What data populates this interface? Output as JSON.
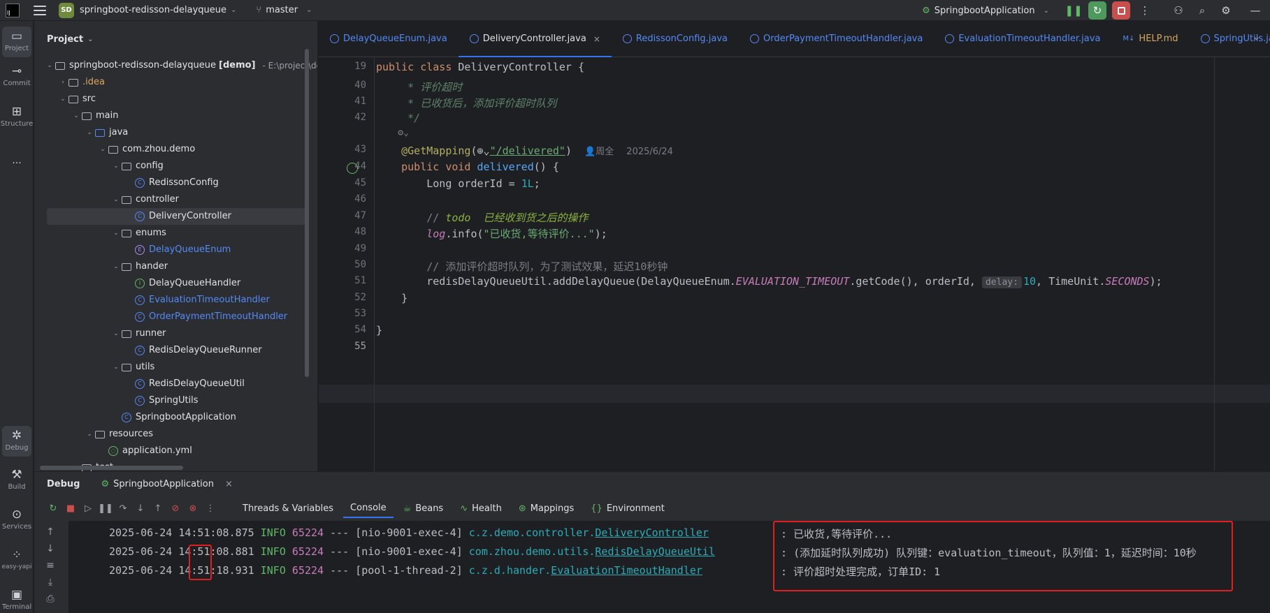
{
  "topbar": {
    "project_badge": "SD",
    "project_name": "springboot-redisson-delayqueue",
    "branch": "master",
    "run_config": "SpringbootApplication"
  },
  "toolstrip": {
    "project": "Project",
    "commit": "Commit",
    "structure": "Structure",
    "more": "···",
    "debug": "Debug",
    "build": "Build",
    "services": "Services",
    "easy_yapi": "easy-yapi",
    "terminal": "Terminal"
  },
  "project_panel": {
    "title": "Project",
    "tree": [
      {
        "label": "springboot-redisson-delayqueue",
        "bold_suffix": "[demo]",
        "path": "- E:\\project\\dela",
        "indent": 0,
        "arrow": "v",
        "icon": "folder"
      },
      {
        "label": ".idea",
        "indent": 1,
        "arrow": ">",
        "icon": "folder",
        "color": "orange"
      },
      {
        "label": "src",
        "indent": 1,
        "arrow": "v",
        "icon": "folder"
      },
      {
        "label": "main",
        "indent": 2,
        "arrow": "v",
        "icon": "folder"
      },
      {
        "label": "java",
        "indent": 3,
        "arrow": "v",
        "icon": "folder-blue"
      },
      {
        "label": "com.zhou.demo",
        "indent": 4,
        "arrow": "v",
        "icon": "folder"
      },
      {
        "label": "config",
        "indent": 5,
        "arrow": "v",
        "icon": "folder"
      },
      {
        "label": "RedissonConfig",
        "indent": 6,
        "arrow": "",
        "icon": "class"
      },
      {
        "label": "controller",
        "indent": 5,
        "arrow": "v",
        "icon": "folder"
      },
      {
        "label": "DeliveryController",
        "indent": 6,
        "arrow": "",
        "icon": "class",
        "selected": true
      },
      {
        "label": "enums",
        "indent": 5,
        "arrow": "v",
        "icon": "folder"
      },
      {
        "label": "DelayQueueEnum",
        "indent": 6,
        "arrow": "",
        "icon": "enum",
        "color": "blue"
      },
      {
        "label": "hander",
        "indent": 5,
        "arrow": "v",
        "icon": "folder"
      },
      {
        "label": "DelayQueueHandler",
        "indent": 6,
        "arrow": "",
        "icon": "interface"
      },
      {
        "label": "EvaluationTimeoutHandler",
        "indent": 6,
        "arrow": "",
        "icon": "class",
        "color": "blue"
      },
      {
        "label": "OrderPaymentTimeoutHandler",
        "indent": 6,
        "arrow": "",
        "icon": "class",
        "color": "blue"
      },
      {
        "label": "runner",
        "indent": 5,
        "arrow": "v",
        "icon": "folder"
      },
      {
        "label": "RedisDelayQueueRunner",
        "indent": 6,
        "arrow": "",
        "icon": "class"
      },
      {
        "label": "utils",
        "indent": 5,
        "arrow": "v",
        "icon": "folder"
      },
      {
        "label": "RedisDelayQueueUtil",
        "indent": 6,
        "arrow": "",
        "icon": "class"
      },
      {
        "label": "SpringUtils",
        "indent": 6,
        "arrow": "",
        "icon": "class"
      },
      {
        "label": "SpringbootApplication",
        "indent": 5,
        "arrow": "",
        "icon": "class"
      },
      {
        "label": "resources",
        "indent": 3,
        "arrow": "v",
        "icon": "folder"
      },
      {
        "label": "application.yml",
        "indent": 4,
        "arrow": "",
        "icon": "yml"
      },
      {
        "label": "test",
        "indent": 2,
        "arrow": ">",
        "icon": "folder"
      }
    ]
  },
  "editor": {
    "tabs": [
      {
        "label": "DelayQueueEnum.java"
      },
      {
        "label": "DeliveryController.java",
        "active": true
      },
      {
        "label": "RedissonConfig.java"
      },
      {
        "label": "OrderPaymentTimeoutHandler.java"
      },
      {
        "label": "EvaluationTimeoutHandler.java"
      },
      {
        "label": "HELP.md",
        "md": true
      },
      {
        "label": "SpringUtils.java"
      }
    ],
    "line_numbers": [
      "19",
      "40",
      "41",
      "42",
      "",
      "43",
      "44",
      "45",
      "46",
      "47",
      "48",
      "49",
      "50",
      "51",
      "52",
      "53",
      "54",
      "55"
    ],
    "code": {
      "l19_kw": "public class ",
      "l19_name": "DeliveryController",
      "l19_rest": " {",
      "l40": "     * 评价超时",
      "l41": "     * 已收货后，添加评价超时队列",
      "l42": "     */",
      "l43_ann": "@GetMapping",
      "l43_path": "\"/delivered\"",
      "l43_author": "周全",
      "l43_date": "2025/6/24",
      "l44_kw": "public void ",
      "l44_fn": "delivered",
      "l44_rest": "() {",
      "l45_type": "Long orderId = ",
      "l45_num": "1L",
      "l47_cm": "// ",
      "l47_todo": "todo  已经收到货之后的操作",
      "l48_log": "log",
      "l48_call": ".info(",
      "l48_str": "\"已收货,等待评价...\"",
      "l48_end": ");",
      "l50": "// 添加评价超时队列，为了测试效果，延迟10秒钟",
      "l51_a": "redisDelayQueueUtil.addDelayQueue(DelayQueueEnum.",
      "l51_field": "EVALUATION_TIMEOUT",
      "l51_b": ".getCode(), orderId, ",
      "l51_hint": "delay:",
      "l51_num": "10",
      "l51_c": ", TimeUnit.",
      "l51_field2": "SECONDS",
      "l51_d": ");",
      "l52": "}",
      "l54": "}"
    }
  },
  "debug": {
    "title": "Debug",
    "session": "SpringbootApplication",
    "subtabs": [
      "Threads & Variables",
      "Console",
      "Beans",
      "Health",
      "Mappings",
      "Environment"
    ],
    "logs": [
      {
        "date": "2025-06-24 14:51:",
        "sec": "08",
        "ms": ".875",
        "level": "INFO",
        "pid": "65224",
        "sep": "---",
        "thread": "[nio-9001-exec-4]",
        "pkg": "c.z.demo.controller.",
        "cls": "DeliveryController",
        "msg": "已收货,等待评价..."
      },
      {
        "date": "2025-06-24 14:51:",
        "sec": "08",
        "ms": ".881",
        "level": "INFO",
        "pid": "65224",
        "sep": "---",
        "thread": "[nio-9001-exec-4]",
        "pkg": "com.zhou.demo.utils.",
        "cls": "RedisDelayQueueUtil",
        "msg": "(添加延时队列成功) 队列键：evaluation_timeout，队列值：1，延迟时间：10秒"
      },
      {
        "date": "2025-06-24 14:51:",
        "sec": "18",
        "ms": ".931",
        "level": "INFO",
        "pid": "65224",
        "sep": "---",
        "thread": "[pool-1-thread-2]",
        "pkg": "c.z.d.hander.",
        "cls": "EvaluationTimeoutHandler",
        "msg": "评价超时处理完成，订单ID: 1"
      }
    ]
  },
  "colors": {
    "accent": "#3574f0",
    "highlight_box": "#e02020"
  }
}
